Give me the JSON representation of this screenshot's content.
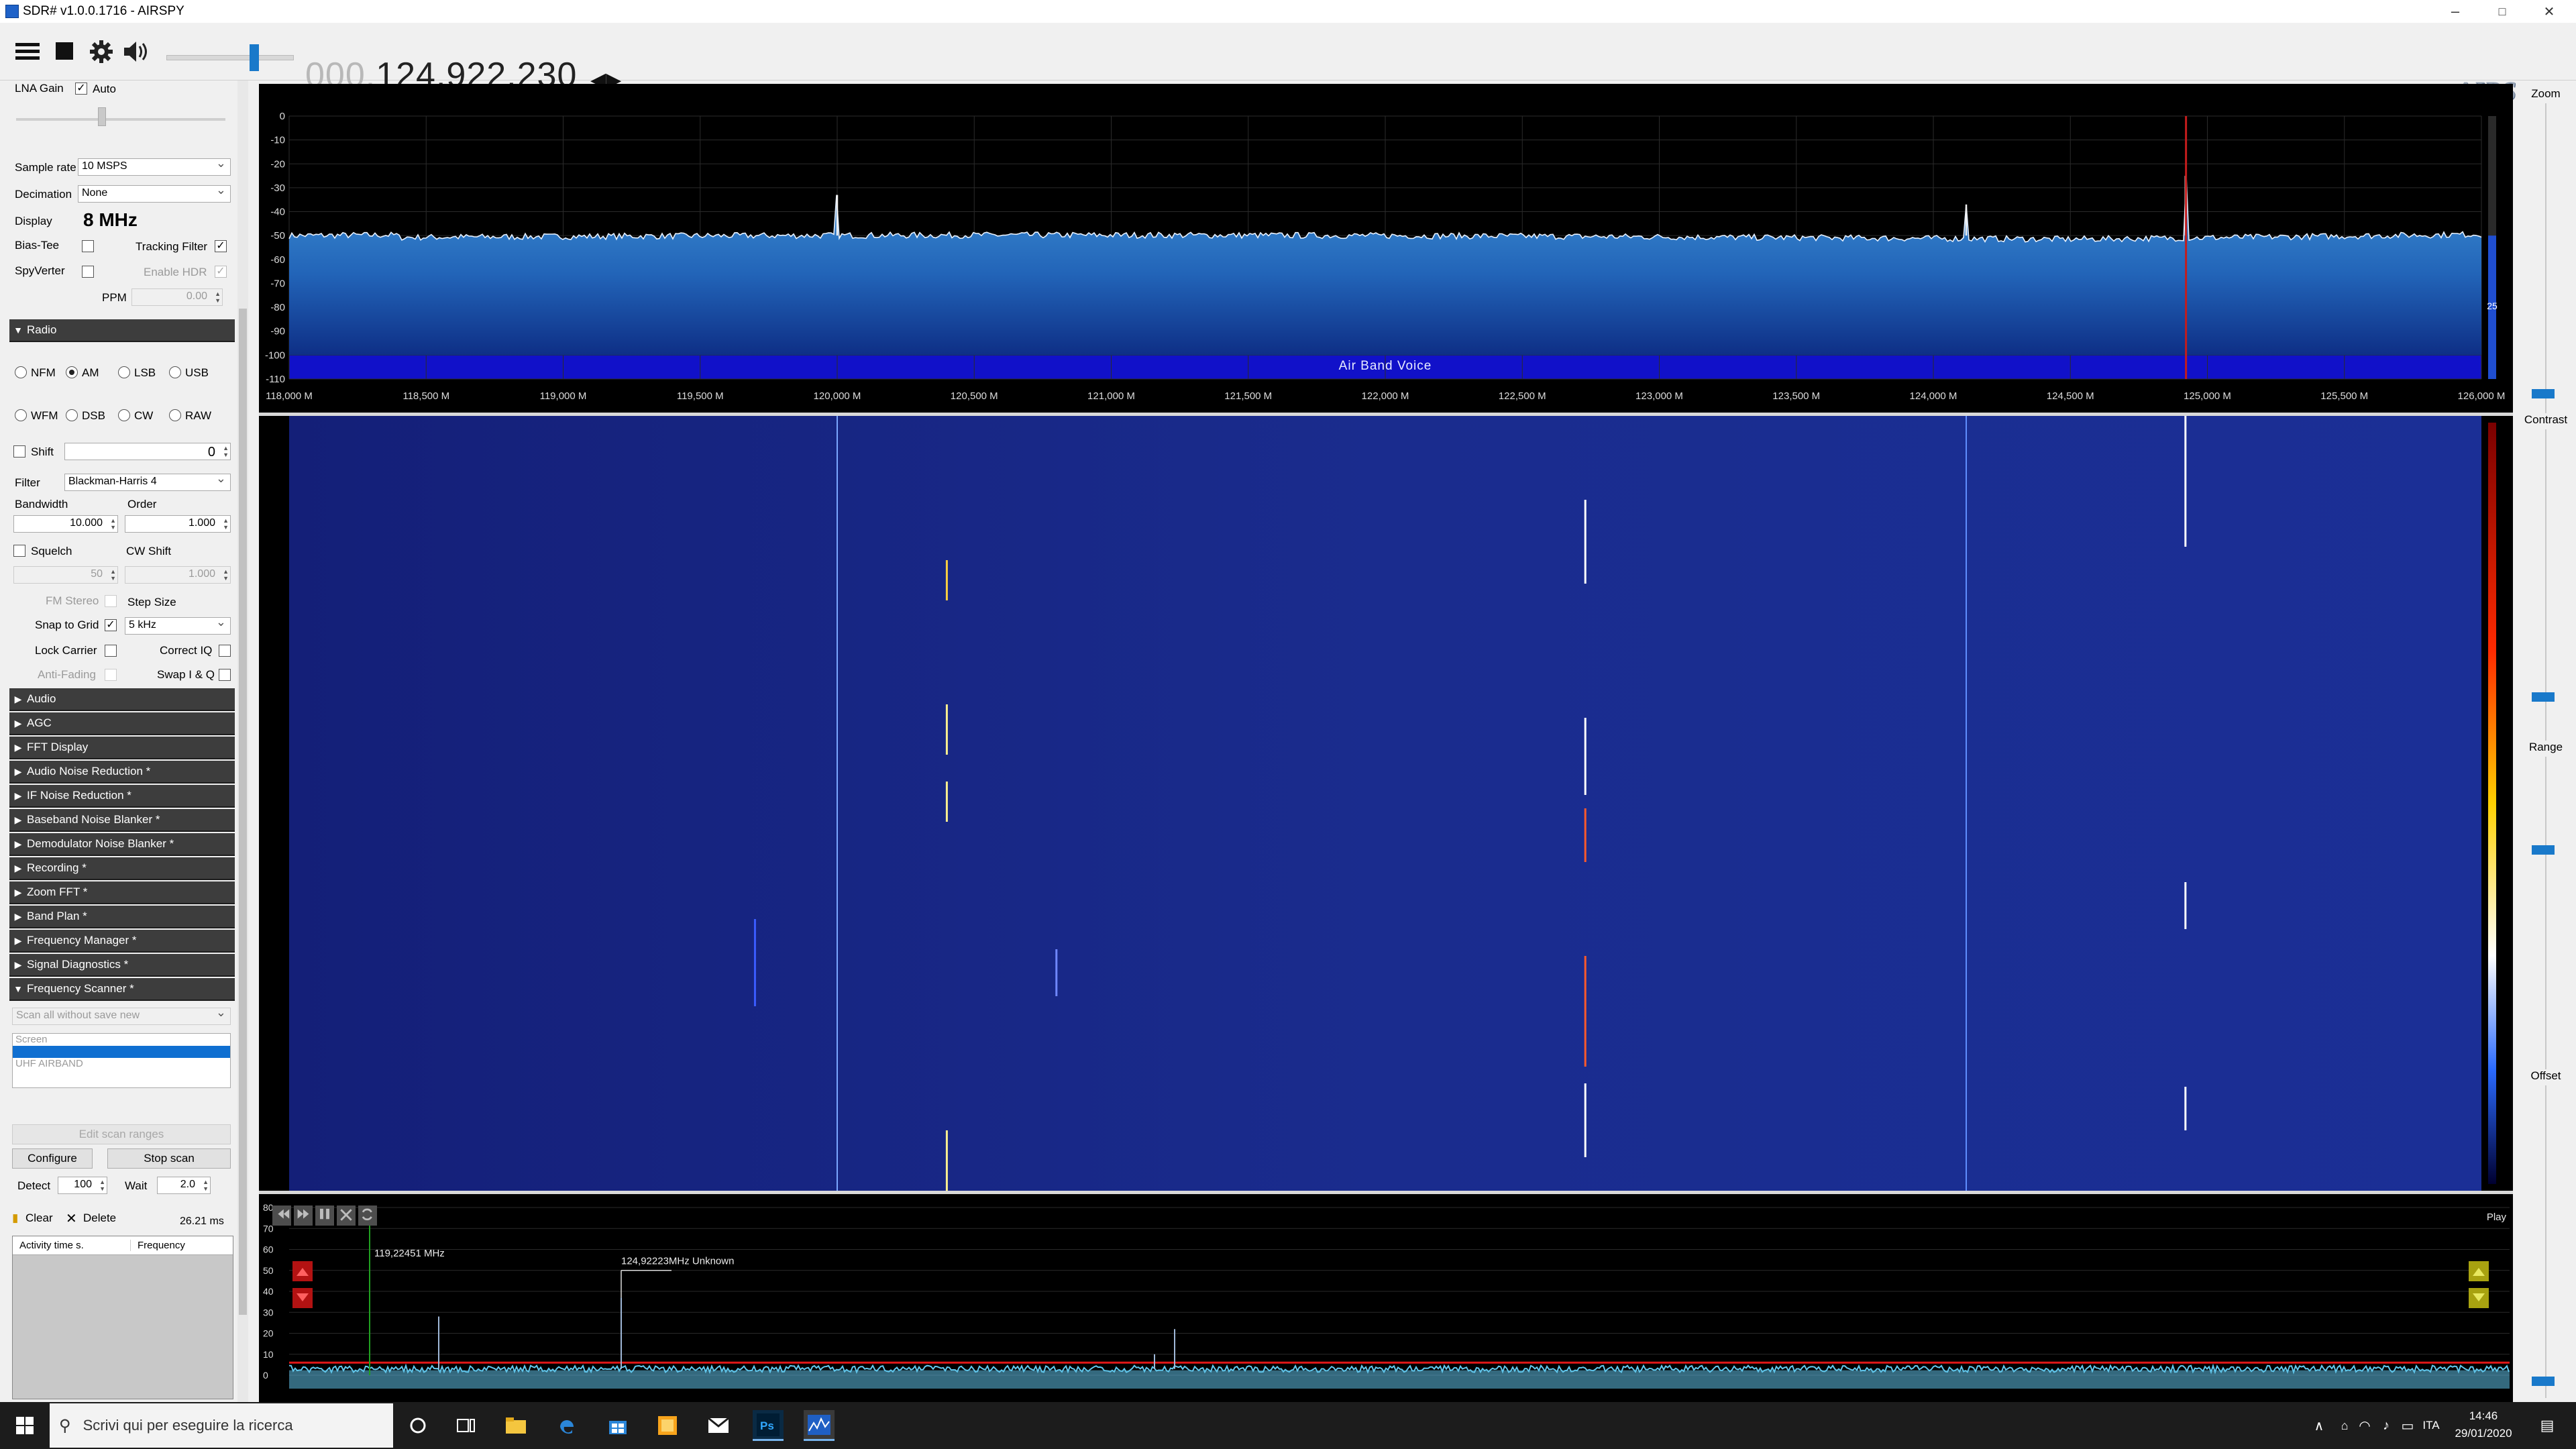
{
  "window": {
    "title": "SDR# v1.0.0.1716 - AIRSPY",
    "minimize": "–",
    "maximize": "□",
    "close": "✕"
  },
  "toolbar": {
    "freq_dim": "000.",
    "freq_main": "124.922.230",
    "freq_arrows": "◀▶",
    "logo": "AIRSPY",
    "volume": 0.72,
    "icons": [
      "menu-icon",
      "stop-icon",
      "gear-icon",
      "speaker-icon"
    ]
  },
  "source": {
    "lna_gain_label": "LNA Gain",
    "auto_label": "Auto",
    "auto_checked": true,
    "sample_rate_label": "Sample rate",
    "sample_rate": "10 MSPS",
    "decimation_label": "Decimation",
    "decimation": "None",
    "display_label": "Display",
    "display_value": "8 MHz",
    "bias_tee_label": "Bias-Tee",
    "bias_tee": false,
    "tracking_label": "Tracking Filter",
    "tracking": true,
    "spyverter_label": "SpyVerter",
    "spyverter": false,
    "hdr_label": "Enable HDR",
    "hdr": true,
    "ppm_label": "PPM",
    "ppm": "0.00"
  },
  "radio": {
    "title": "Radio",
    "modes": [
      "NFM",
      "AM",
      "LSB",
      "USB",
      "WFM",
      "DSB",
      "CW",
      "RAW"
    ],
    "selected_mode": "AM",
    "shift_label": "Shift",
    "shift_value": "0",
    "filter_label": "Filter",
    "filter_value": "Blackman-Harris 4",
    "bandwidth_label": "Bandwidth",
    "bandwidth": "10.000",
    "order_label": "Order",
    "order": "1.000",
    "squelch_label": "Squelch",
    "cw_shift_label": "CW Shift",
    "squelch_value": "50",
    "cw_shift_value": "1.000",
    "fm_stereo_label": "FM Stereo",
    "step_size_label": "Step Size",
    "snap_label": "Snap to Grid",
    "snap_checked": true,
    "step_value": "5 kHz",
    "lock_carrier_label": "Lock Carrier",
    "correct_iq_label": "Correct IQ",
    "anti_fading_label": "Anti-Fading",
    "swap_iq_label": "Swap I & Q"
  },
  "sections": [
    "Audio",
    "AGC",
    "FFT Display",
    "Audio Noise Reduction *",
    "IF Noise Reduction *",
    "Baseband Noise Blanker *",
    "Demodulator Noise Blanker *",
    "Recording *",
    "Zoom FFT *",
    "Band Plan *",
    "Frequency Manager *",
    "Signal Diagnostics *",
    "Frequency Scanner *"
  ],
  "scanner": {
    "mode": "Scan all without save new",
    "list": [
      "Screen",
      "",
      "UHF AIRBAND"
    ],
    "edit_ranges": "Edit scan ranges",
    "configure": "Configure",
    "stop_scan": "Stop scan",
    "detect_label": "Detect",
    "detect": "100",
    "wait_label": "Wait",
    "wait": "2.0",
    "clear": "Clear",
    "delete": "Delete",
    "timing": "26.21 ms",
    "col_activity": "Activity time s.",
    "col_frequency": "Frequency"
  },
  "spectrum": {
    "db_ticks": [
      "0",
      "-10",
      "-20",
      "-30",
      "-40",
      "-50",
      "-60",
      "-70",
      "-80",
      "-90",
      "-100",
      "-110"
    ],
    "freq_ticks": [
      "118,000 M",
      "118,500 M",
      "119,000 M",
      "119,500 M",
      "120,000 M",
      "120,500 M",
      "121,000 M",
      "121,500 M",
      "122,000 M",
      "122,500 M",
      "123,000 M",
      "123,500 M",
      "124,000 M",
      "124,500 M",
      "125,000 M",
      "125,500 M",
      "126,000 M"
    ],
    "band_label": "Air Band Voice",
    "range_value": "25",
    "f_start_mhz": 118.0,
    "f_end_mhz": 126.0,
    "tuned_mhz": 124.922,
    "peaks": [
      {
        "mhz": 120.0,
        "db": -33
      },
      {
        "mhz": 124.12,
        "db": -37
      },
      {
        "mhz": 124.92,
        "db": -25
      }
    ]
  },
  "waterfall": {
    "signals_mhz": [
      119.7,
      120.0,
      120.4,
      120.8,
      122.73,
      124.12,
      124.92
    ]
  },
  "scanner_panel": {
    "y_ticks": [
      "80",
      "70",
      "60",
      "50",
      "40",
      "30",
      "20",
      "10",
      "0"
    ],
    "current_freq": "119,22451 MHz",
    "hit_label": "124,92223MHz Unknown",
    "play_label": "Play",
    "threshold_db": 6
  },
  "right_panel": {
    "zoom_label": "Zoom",
    "contrast_label": "Contrast",
    "range_label": "Range",
    "offset_label": "Offset"
  },
  "taskbar": {
    "search_placeholder": "Scrivi qui per eseguire la ricerca",
    "lang": "ITA",
    "time": "14:46",
    "date": "29/01/2020"
  }
}
